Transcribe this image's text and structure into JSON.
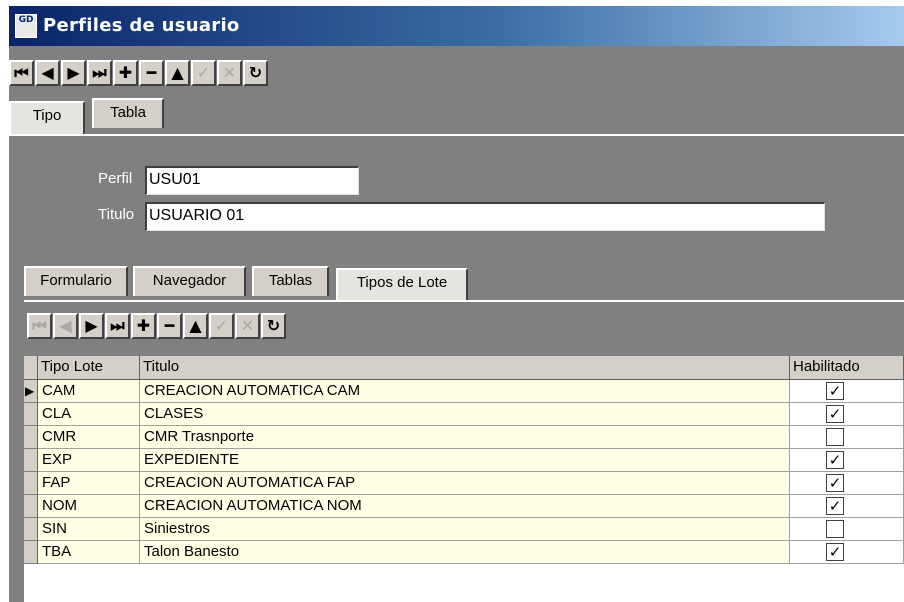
{
  "window": {
    "title": "Perfiles de usuario",
    "icon_text": "GD"
  },
  "toolbar1": [
    {
      "name": "first-record-button",
      "glyph": "⏮",
      "enabled": true
    },
    {
      "name": "prior-record-button",
      "glyph": "◀",
      "enabled": true
    },
    {
      "name": "next-record-button",
      "glyph": "▶",
      "enabled": true
    },
    {
      "name": "last-record-button",
      "glyph": "⏭",
      "enabled": true
    },
    {
      "name": "insert-record-button",
      "glyph": "✚",
      "enabled": true
    },
    {
      "name": "delete-record-button",
      "glyph": "━",
      "enabled": true
    },
    {
      "name": "edit-record-button",
      "glyph": "▲",
      "enabled": true
    },
    {
      "name": "post-record-button",
      "glyph": "✓",
      "enabled": false
    },
    {
      "name": "cancel-record-button",
      "glyph": "✕",
      "enabled": false
    },
    {
      "name": "refresh-button",
      "glyph": "↻",
      "enabled": true
    }
  ],
  "outer_tabs": [
    {
      "label": "Tipo"
    },
    {
      "label": "Tabla"
    }
  ],
  "form": {
    "perfil_label": "Perfil",
    "perfil_value": "USU01",
    "titulo_label": "Titulo",
    "titulo_value": "USUARIO 01"
  },
  "inner_tabs": [
    {
      "label": "Formulario"
    },
    {
      "label": "Navegador"
    },
    {
      "label": "Tablas"
    },
    {
      "label": "Tipos de Lote"
    }
  ],
  "toolbar2": [
    {
      "name": "first-record-button",
      "glyph": "⏮",
      "enabled": false
    },
    {
      "name": "prior-record-button",
      "glyph": "◀",
      "enabled": false
    },
    {
      "name": "next-record-button",
      "glyph": "▶",
      "enabled": true
    },
    {
      "name": "last-record-button",
      "glyph": "⏭",
      "enabled": true
    },
    {
      "name": "insert-record-button",
      "glyph": "✚",
      "enabled": true
    },
    {
      "name": "delete-record-button",
      "glyph": "━",
      "enabled": true
    },
    {
      "name": "edit-record-button",
      "glyph": "▲",
      "enabled": true
    },
    {
      "name": "post-record-button",
      "glyph": "✓",
      "enabled": false
    },
    {
      "name": "cancel-record-button",
      "glyph": "✕",
      "enabled": false
    },
    {
      "name": "refresh-button",
      "glyph": "↻",
      "enabled": true
    }
  ],
  "grid": {
    "columns": [
      "Tipo Lote",
      "Titulo",
      "Habilitado"
    ],
    "current_row_marker": "▶",
    "rows": [
      {
        "tipo": "CAM",
        "titulo": "CREACION AUTOMATICA CAM",
        "habilitado": true,
        "current": true
      },
      {
        "tipo": "CLA",
        "titulo": "CLASES",
        "habilitado": true,
        "current": false
      },
      {
        "tipo": "CMR",
        "titulo": "CMR Trasnporte",
        "habilitado": false,
        "current": false
      },
      {
        "tipo": "EXP",
        "titulo": "EXPEDIENTE",
        "habilitado": true,
        "current": false
      },
      {
        "tipo": "FAP",
        "titulo": "CREACION AUTOMATICA FAP",
        "habilitado": true,
        "current": false
      },
      {
        "tipo": "NOM",
        "titulo": "CREACION AUTOMATICA NOM",
        "habilitado": true,
        "current": false
      },
      {
        "tipo": "SIN",
        "titulo": "Siniestros",
        "habilitado": false,
        "current": false
      },
      {
        "tipo": "TBA",
        "titulo": "Talon Banesto",
        "habilitado": true,
        "current": false
      }
    ]
  }
}
